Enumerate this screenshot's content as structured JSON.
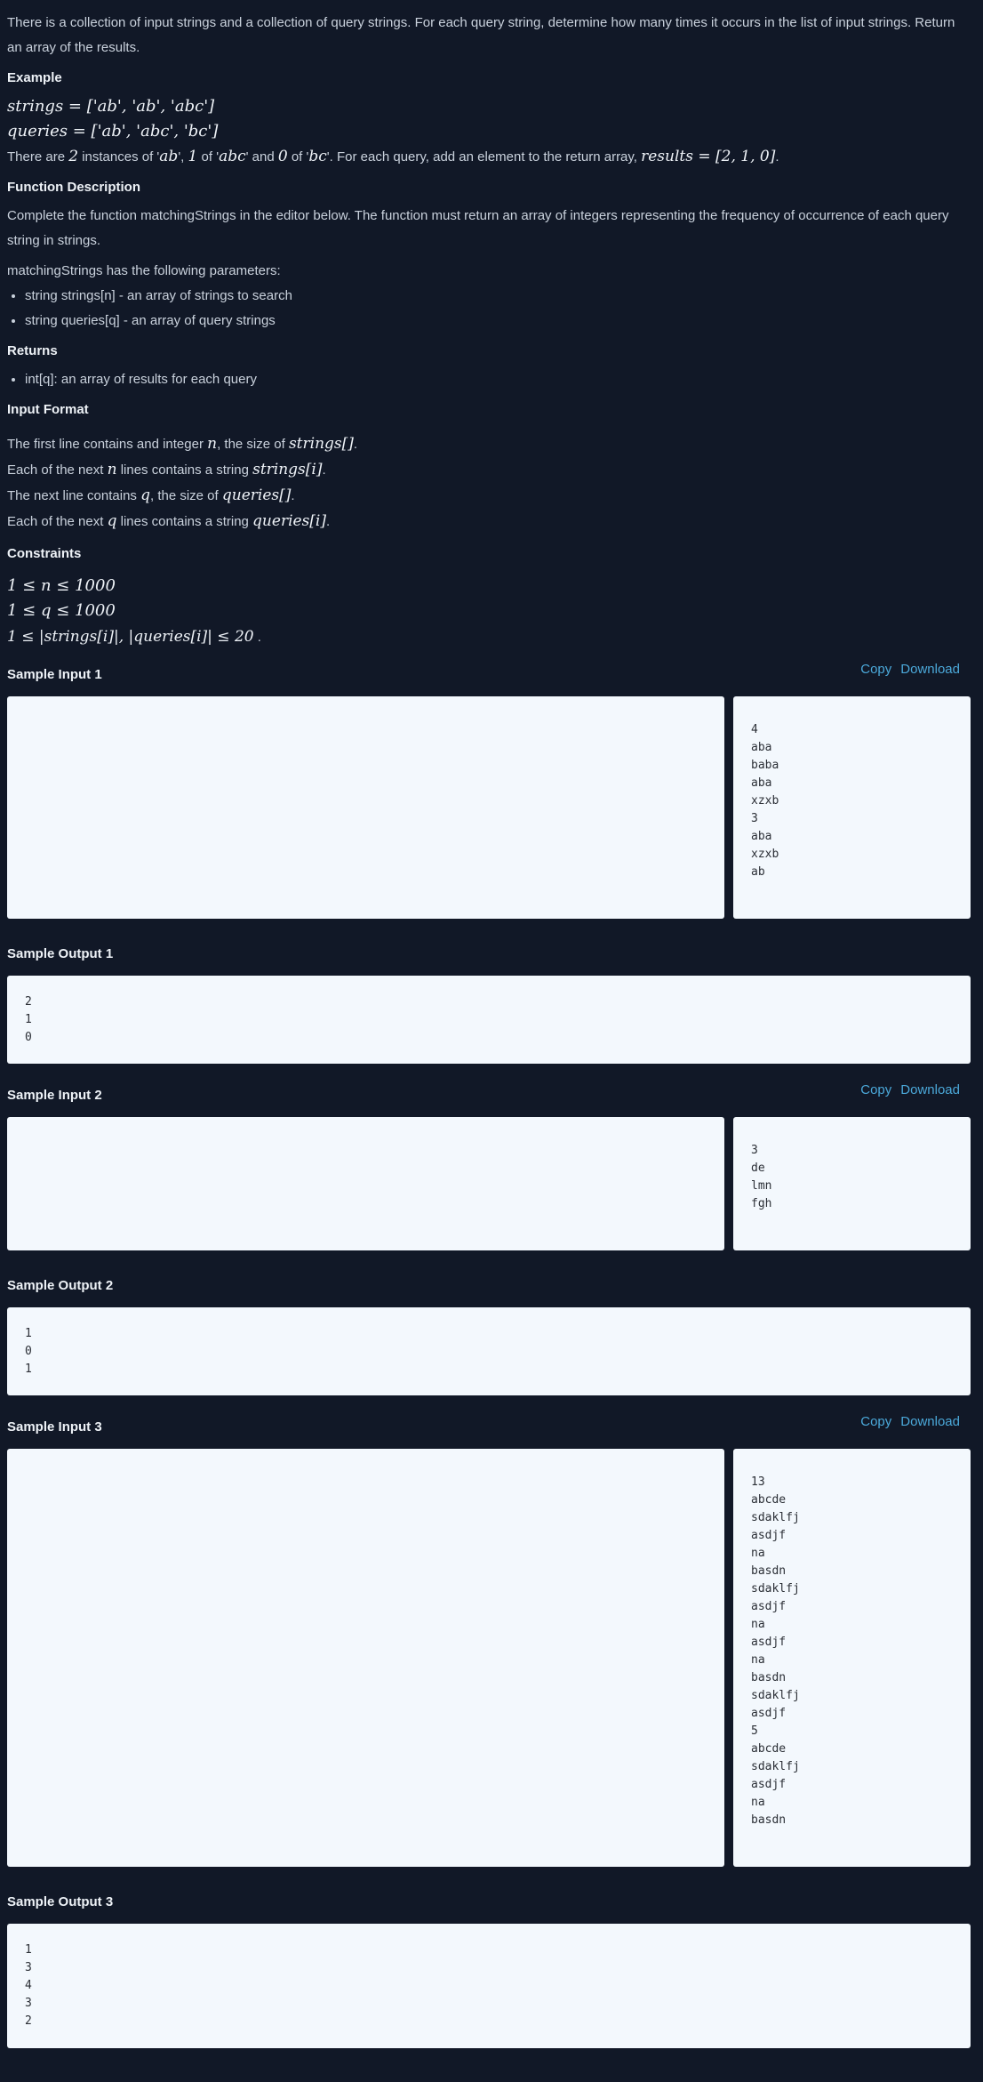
{
  "intro": "There is a collection of input strings and a collection of query strings. For each query string, determine how many times it occurs in the list of input strings. Return an array of the results.",
  "example": {
    "heading": "Example",
    "strings_line": "strings = ['ab', 'ab', 'abc']",
    "queries_line": "queries = ['ab', 'abc', 'bc']",
    "explanation_parts": [
      "There are ",
      "2",
      " instances of '",
      "ab",
      "', ",
      "1",
      " of '",
      "abc",
      "' and ",
      "0",
      " of '",
      "bc",
      "'. For each query, add an element to the return array, ",
      "results = [2, 1, 0]",
      "."
    ]
  },
  "function_description": {
    "heading": "Function Description",
    "text": "Complete the function matchingStrings in the editor below. The function must return an array of integers representing the frequency of occurrence of each query string in strings.",
    "params_intro": "matchingStrings has the following parameters:",
    "params": [
      "string strings[n] - an array of strings to search",
      "string queries[q] - an array of query strings"
    ]
  },
  "returns": {
    "heading": "Returns",
    "items": [
      "int[q]: an array of results for each query"
    ]
  },
  "input_format": {
    "heading": "Input Format",
    "l1_pre": "The first line contains and integer ",
    "l1_var": "n",
    "l1_mid": ", the size of ",
    "l1_math": "strings[]",
    "l1_end": ".",
    "l2_pre": "Each of the next ",
    "l2_var": "n",
    "l2_mid": " lines contains a string ",
    "l2_math": "strings[i]",
    "l2_end": ".",
    "l3_pre": "The next line contains ",
    "l3_var": "q",
    "l3_mid": ", the size of ",
    "l3_math": "queries[]",
    "l3_end": ".",
    "l4_pre": "Each of the next ",
    "l4_var": "q",
    "l4_mid": " lines contains a string ",
    "l4_math": "queries[i]",
    "l4_end": "."
  },
  "constraints": {
    "heading": "Constraints",
    "c1": "1 ≤ n ≤ 1000",
    "c2": "1 ≤ q ≤ 1000",
    "c3": "1 ≤ |strings[i]|, |queries[i]| ≤ 20",
    "c3_end": " ."
  },
  "links": {
    "copy": "Copy",
    "download": "Download"
  },
  "samples": [
    {
      "input_title": "Sample Input 1",
      "input": "4\naba\nbaba\naba\nxzxb\n3\naba\nxzxb\nab",
      "output_title": "Sample Output 1",
      "output": "2\n1\n0"
    },
    {
      "input_title": "Sample Input 2",
      "input": "3\nde\nlmn\nfgh",
      "output_title": "Sample Output 2",
      "output": "1\n0\n1"
    },
    {
      "input_title": "Sample Input 3",
      "input": "13\nabcde\nsdaklfj\nasdjf\nna\nbasdn\nsdaklfj\nasdjf\nna\nasdjf\nna\nbasdn\nsdaklfj\nasdjf\n5\nabcde\nsdaklfj\nasdjf\nna\nbasdn",
      "output_title": "Sample Output 3",
      "output": "1\n3\n4\n3\n2"
    }
  ]
}
